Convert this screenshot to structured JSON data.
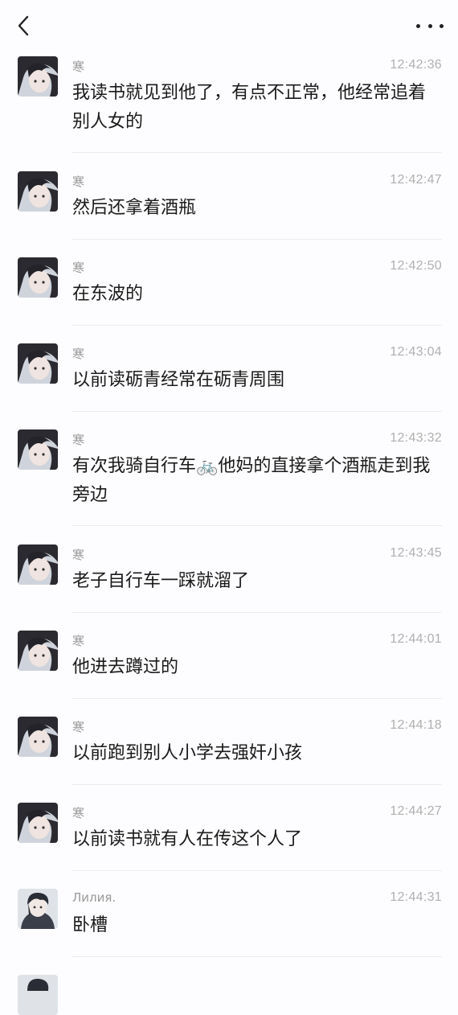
{
  "header": {
    "back_icon": "chevron-left-icon",
    "more_icon": "more-horizontal-icon"
  },
  "messages": [
    {
      "sender": "寒",
      "time": "12:42:36",
      "text": "我读书就见到他了，有点不正常，他经常追着别人女的"
    },
    {
      "sender": "寒",
      "time": "12:42:47",
      "text": "然后还拿着酒瓶"
    },
    {
      "sender": "寒",
      "time": "12:42:50",
      "text": "在东波的"
    },
    {
      "sender": "寒",
      "time": "12:43:04",
      "text": "以前读砺青经常在砺青周围"
    },
    {
      "sender": "寒",
      "time": "12:43:32",
      "text": "有次我骑自行车🚲他妈的直接拿个酒瓶走到我旁边"
    },
    {
      "sender": "寒",
      "time": "12:43:45",
      "text": "老子自行车一踩就溜了"
    },
    {
      "sender": "寒",
      "time": "12:44:01",
      "text": "他进去蹲过的"
    },
    {
      "sender": "寒",
      "time": "12:44:18",
      "text": "以前跑到别人小学去强奸小孩"
    },
    {
      "sender": "寒",
      "time": "12:44:27",
      "text": "以前读书就有人在传这个人了"
    },
    {
      "sender": "Лилия.",
      "time": "12:44:31",
      "text": "卧槽"
    }
  ]
}
